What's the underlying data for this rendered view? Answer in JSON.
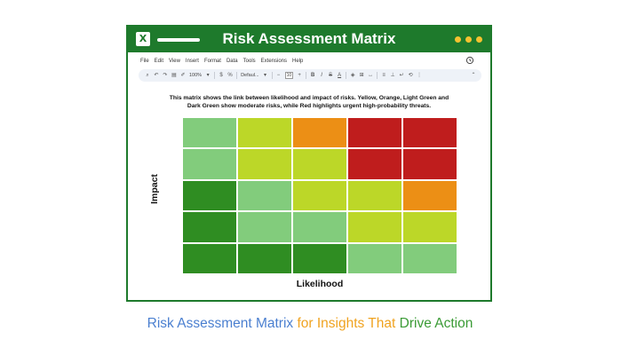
{
  "window": {
    "title": "Risk Assessment Matrix",
    "logo_letter": "X",
    "accent_color": "#1e7a2c",
    "dot_color": "#f5c230"
  },
  "menu": [
    "File",
    "Edit",
    "View",
    "Insert",
    "Format",
    "Data",
    "Tools",
    "Extensions",
    "Help"
  ],
  "toolbar": {
    "zoom": "100%",
    "font": "Defaul...",
    "font_size": "10"
  },
  "description": "This matrix shows the link between likelihood and impact of risks. Yellow, Orange, Light Green and Dark Green show moderate risks, while Red highlights urgent high-probability threats.",
  "matrix": {
    "y_axis_label": "Impact",
    "x_axis_label": "Likelihood",
    "palette": {
      "light_green": "#82cc7c",
      "yellow_green": "#bcd728",
      "orange": "#ec8f15",
      "red": "#bf1d1d",
      "dark_green": "#2f8d22"
    },
    "rows": [
      [
        "light_green",
        "yellow_green",
        "orange",
        "red",
        "red"
      ],
      [
        "light_green",
        "yellow_green",
        "yellow_green",
        "red",
        "red"
      ],
      [
        "dark_green",
        "light_green",
        "yellow_green",
        "yellow_green",
        "orange"
      ],
      [
        "dark_green",
        "light_green",
        "light_green",
        "yellow_green",
        "yellow_green"
      ],
      [
        "dark_green",
        "dark_green",
        "dark_green",
        "light_green",
        "light_green"
      ]
    ]
  },
  "caption": {
    "part1": "Risk Assessment Matrix",
    "part2": "for Insights That",
    "part3": "Drive Action"
  }
}
